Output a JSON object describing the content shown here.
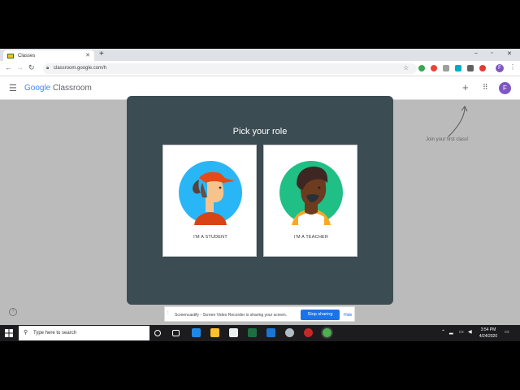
{
  "browser": {
    "tab_title": "Classes",
    "new_tab_symbol": "+",
    "url": "classroom.google.com/h"
  },
  "app": {
    "brand_google": "Google",
    "brand_product": "Classroom",
    "profile_initial": "F",
    "join_hint": "Join your first class!"
  },
  "modal": {
    "title": "Pick your role",
    "student_label": "I'M A STUDENT",
    "teacher_label": "I'M A TEACHER"
  },
  "screencastify": {
    "message": "Screencastify - Screen Video Recorder is sharing your screen.",
    "stop_label": "Stop sharing",
    "hide_label": "Hide"
  },
  "taskbar": {
    "search_placeholder": "Type here to search",
    "time": "3:54 PM",
    "date": "4/24/2020"
  },
  "colors": {
    "modal_bg": "#3b4c53",
    "student_circle": "#29b6f6",
    "teacher_circle": "#1fbf86",
    "accent_blue": "#1a73e8",
    "profile": "#7e57c2"
  }
}
